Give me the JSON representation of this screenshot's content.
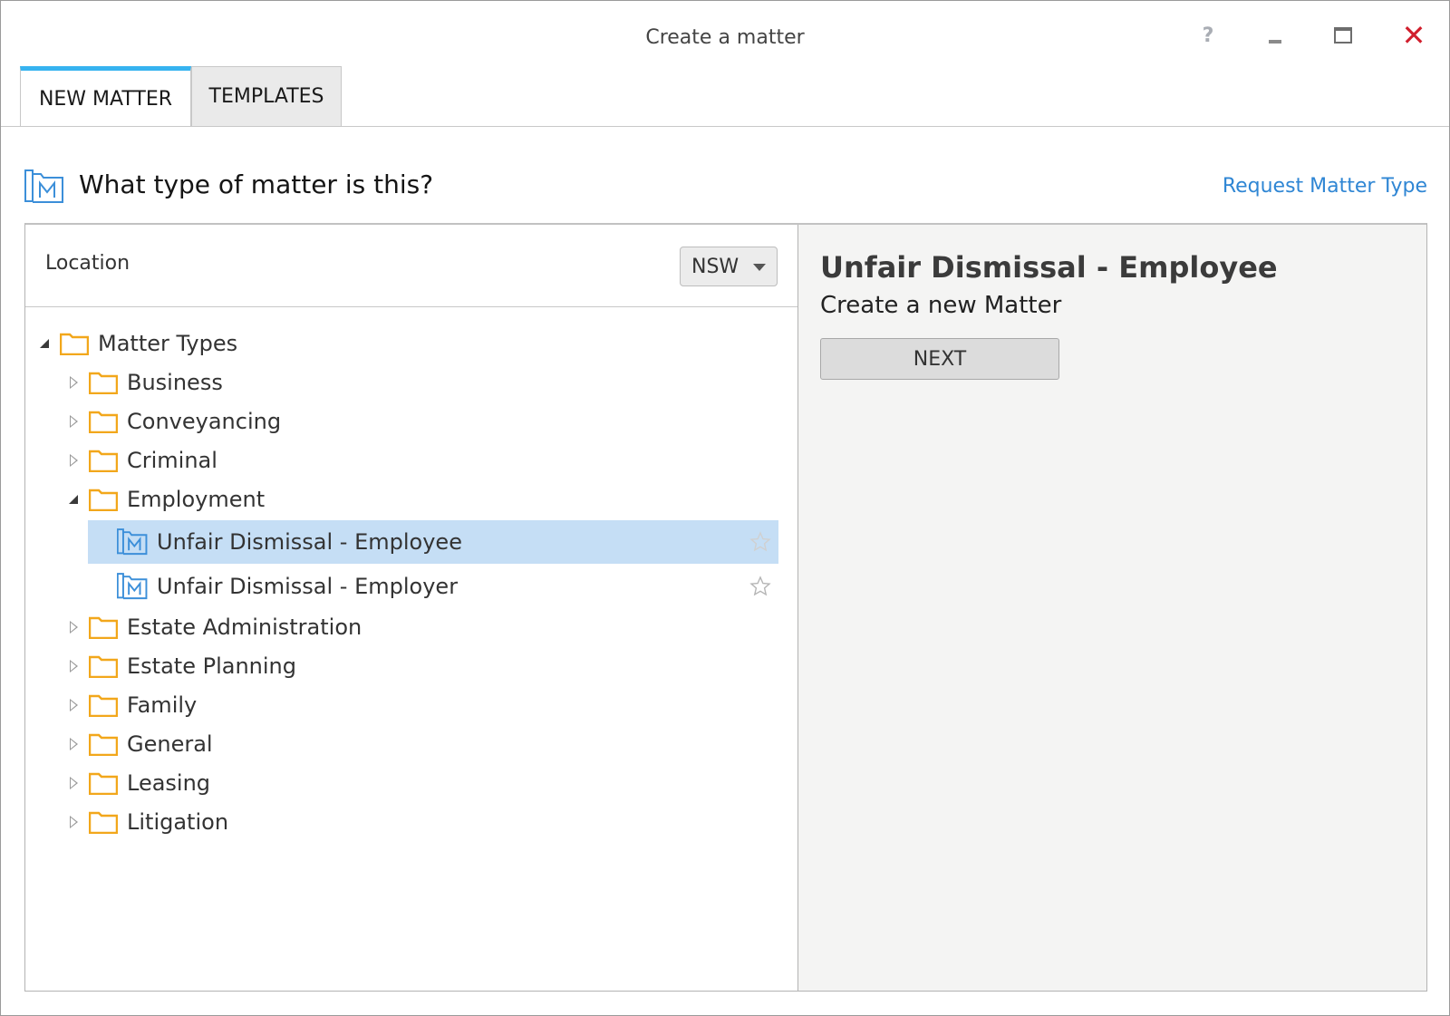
{
  "window": {
    "title": "Create a matter",
    "help_label": "?",
    "close_label": "✕"
  },
  "tabs": [
    {
      "label": "NEW MATTER",
      "active": true
    },
    {
      "label": "TEMPLATES",
      "active": false
    }
  ],
  "heading": {
    "question": "What type of matter is this?",
    "request_link": "Request Matter Type"
  },
  "location": {
    "label": "Location",
    "selected": "NSW"
  },
  "tree": {
    "root": {
      "label": "Matter Types",
      "expanded": true
    },
    "folders": [
      {
        "label": "Business",
        "expanded": false
      },
      {
        "label": "Conveyancing",
        "expanded": false
      },
      {
        "label": "Criminal",
        "expanded": false
      },
      {
        "label": "Employment",
        "expanded": true
      },
      {
        "label": "Estate Administration",
        "expanded": false
      },
      {
        "label": "Estate Planning",
        "expanded": false
      },
      {
        "label": "Family",
        "expanded": false
      },
      {
        "label": "General",
        "expanded": false
      },
      {
        "label": "Leasing",
        "expanded": false
      },
      {
        "label": "Litigation",
        "expanded": false
      }
    ],
    "employment_items": [
      {
        "label": "Unfair Dismissal - Employee",
        "selected": true
      },
      {
        "label": "Unfair Dismissal - Employer",
        "selected": false
      }
    ]
  },
  "detail": {
    "title": "Unfair Dismissal - Employee",
    "subtitle": "Create a new Matter",
    "next_label": "NEXT"
  },
  "colors": {
    "accent_tab": "#36b3f0",
    "link": "#2f86d4",
    "folder": "#f2a71b",
    "matter_icon": "#3c8fd9",
    "selection": "#c5def5",
    "close": "#d11f2d"
  },
  "icons": {
    "folder": "folder-icon",
    "matter_type": "matter-type-icon",
    "favorite": "star-icon",
    "dropdown": "chevron-down-icon"
  }
}
